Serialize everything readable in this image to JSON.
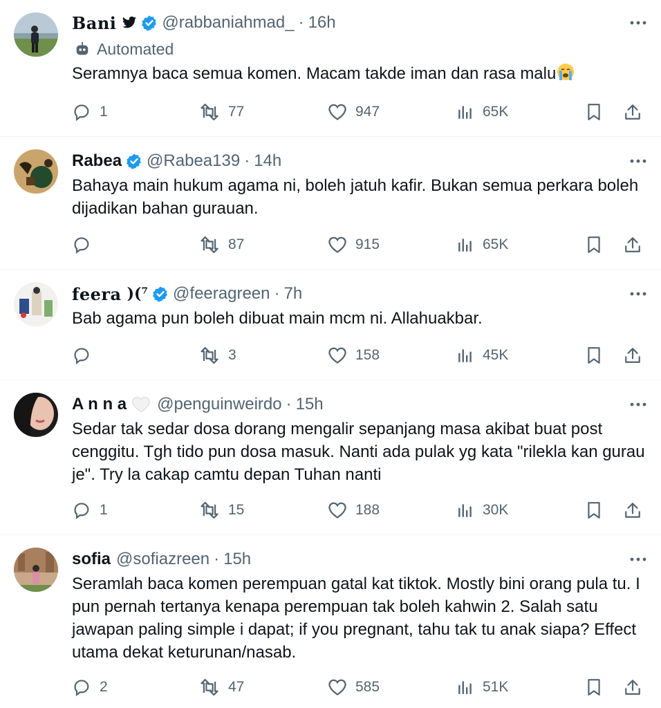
{
  "colors": {
    "text": "#0f1419",
    "secondary": "#536471",
    "verified": "#1d9bf0",
    "divider": "#eff3f4"
  },
  "tweets": [
    {
      "name": "Bani",
      "extra_icon": "bird-logo-icon",
      "verified": true,
      "handle": "@rabbaniahmad_",
      "dot": "·",
      "time": "16h",
      "automated_label": "Automated",
      "text": "Seramnya baca semua komen. Macam takde iman dan rasa malu",
      "emoji": "loudly-crying-face-icon",
      "replies": "1",
      "retweets": "77",
      "likes": "947",
      "views": "65K"
    },
    {
      "name": "Rabea",
      "verified": true,
      "handle": "@Rabea139",
      "dot": "·",
      "time": "14h",
      "text": "Bahaya main hukum agama ni, boleh jatuh kafir. Bukan semua perkara boleh dijadikan bahan gurauan.",
      "replies": "",
      "retweets": "87",
      "likes": "915",
      "views": "65K"
    },
    {
      "name": "feera",
      "name_extra": ")⁠(⁷",
      "verified": true,
      "handle": "@feeragreen",
      "dot": "·",
      "time": "7h",
      "text": "Bab agama pun boleh dibuat main mcm ni. Allahuakbar.",
      "replies": "",
      "retweets": "3",
      "likes": "158",
      "views": "45K"
    },
    {
      "name": "A n n a",
      "extra_icon": "white-heart-icon",
      "verified": false,
      "handle": "@penguinweirdo",
      "dot": "·",
      "time": "15h",
      "text": "Sedar tak sedar dosa dorang mengalir sepanjang masa akibat buat post cenggitu. Tgh tido pun dosa masuk. Nanti ada pulak yg kata \"rilekla kan gurau je\". Try la cakap camtu depan Tuhan nanti",
      "replies": "1",
      "retweets": "15",
      "likes": "188",
      "views": "30K"
    },
    {
      "name": "sofia",
      "verified": false,
      "handle": "@sofiazreen",
      "dot": "·",
      "time": "15h",
      "text": "Seramlah baca komen perempuan gatal kat tiktok. Mostly bini orang pula tu. I pun pernah tertanya kenapa perempuan tak boleh kahwin 2. Salah satu jawapan paling simple i dapat; if you pregnant, tahu tak tu anak siapa? Effect utama dekat keturunan/nasab.",
      "replies": "2",
      "retweets": "47",
      "likes": "585",
      "views": "51K"
    }
  ]
}
